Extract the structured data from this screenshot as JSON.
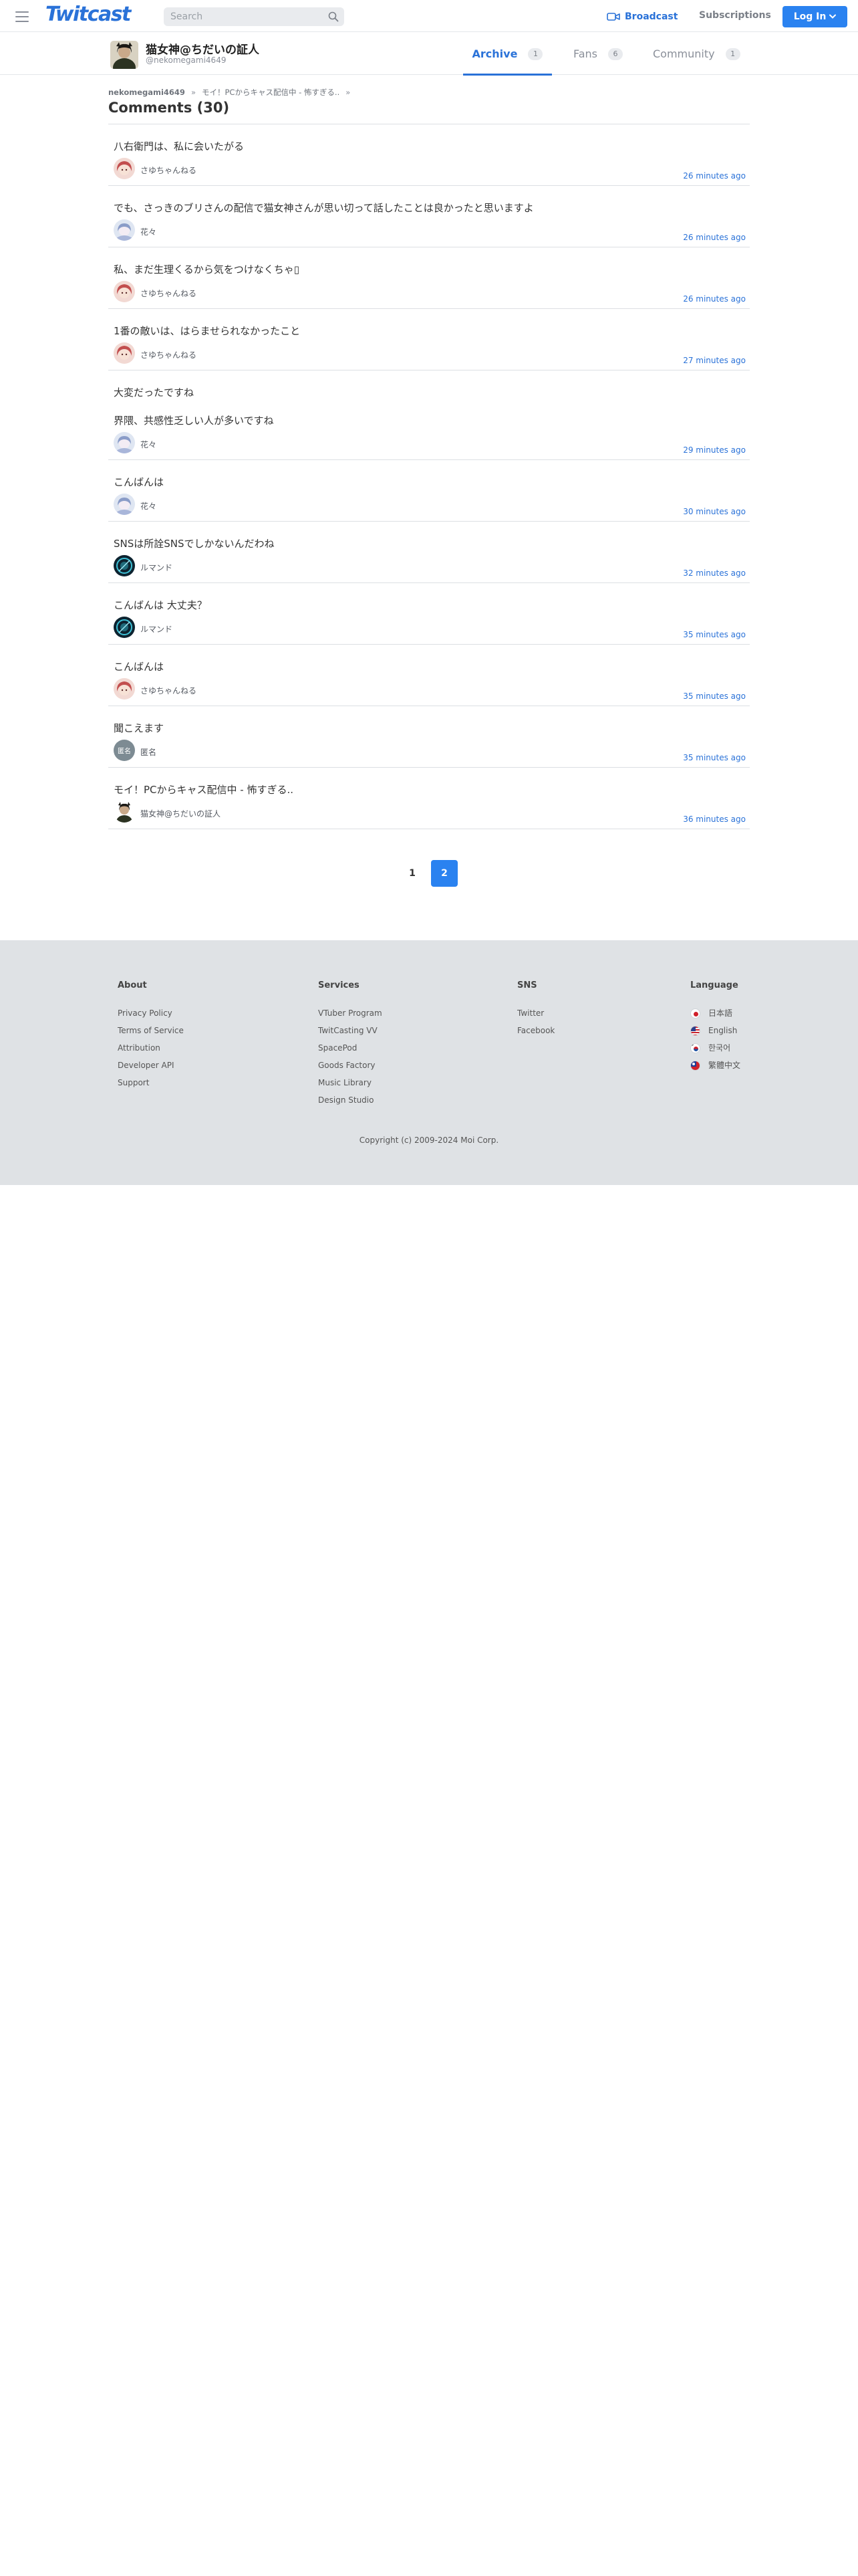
{
  "header": {
    "logo": "Twitcast",
    "search_placeholder": "Search",
    "broadcast_label": "Broadcast",
    "subscriptions_label": "Subscriptions",
    "login_label": "Log In"
  },
  "profile": {
    "name": "猫女神@ちだいの証人",
    "handle": "@nekomegami4649"
  },
  "tabs": [
    {
      "label": "Archive",
      "count": "1",
      "active": true
    },
    {
      "label": "Fans",
      "count": "6",
      "active": false
    },
    {
      "label": "Community",
      "count": "1",
      "active": false
    }
  ],
  "breadcrumb": {
    "user": "nekomegami4649",
    "separator": "»",
    "movie": "モイ！PCからキャス配信中 -   怖すぎる.."
  },
  "page_title": "Comments (30)",
  "comments": [
    {
      "text": "八右衛門は、私に会いたがる",
      "extra": "",
      "user": "さゆちゃんねる",
      "time": "26 minutes ago"
    },
    {
      "text": "でも、さっきのブリさんの配信で猫女神さんが思い切って話したことは良かったと思いますよ",
      "extra": "",
      "user": "花々",
      "time": "26 minutes ago"
    },
    {
      "text": "私、まだ生理くるから気をつけなくちゃ▯",
      "extra": "",
      "user": "さゆちゃんねる",
      "time": "26 minutes ago"
    },
    {
      "text": "1番の敵いは、はらませられなかったこと",
      "extra": "",
      "user": "さゆちゃんねる",
      "time": "27 minutes ago"
    },
    {
      "text": "大変だったですね",
      "extra": "界隈、共感性乏しい人が多いですね",
      "user": "花々",
      "time": "29 minutes ago"
    },
    {
      "text": "こんばんは",
      "extra": "",
      "user": "花々",
      "time": "30 minutes ago"
    },
    {
      "text": "SNSは所詮SNSでしかないんだわね",
      "extra": "",
      "user": "ルマンド",
      "time": "32 minutes ago"
    },
    {
      "text": "こんばんは 大丈夫？",
      "extra": "",
      "user": "ルマンド",
      "time": "35 minutes ago"
    },
    {
      "text": "こんばんは",
      "extra": "",
      "user": "さゆちゃんねる",
      "time": "35 minutes ago"
    },
    {
      "text": "聞こえます",
      "extra": "",
      "user": "匿名",
      "time": "35 minutes ago"
    },
    {
      "text": "モイ！PCからキャス配信中 -   怖すぎる..",
      "extra": "",
      "user": "猫女神@ちだいの証人",
      "time": "36 minutes ago"
    }
  ],
  "avatars": {
    "匿名": {
      "label": "匿名",
      "color": "#7d8b93"
    }
  },
  "pagination": {
    "pages": [
      "1",
      "2"
    ],
    "current": "2"
  },
  "footer": {
    "about": {
      "heading": "About",
      "links": [
        "Privacy Policy",
        "Terms of Service",
        "Attribution",
        "Developer API",
        "Support"
      ]
    },
    "services": {
      "heading": "Services",
      "links": [
        "VTuber Program",
        "TwitCasting VV",
        "SpacePod",
        "Goods Factory",
        "Music Library",
        "Design Studio"
      ]
    },
    "sns": {
      "heading": "SNS",
      "links": [
        "Twitter",
        "Facebook"
      ]
    },
    "language": {
      "heading": "Language",
      "links": [
        "日本語",
        "English",
        "한국어",
        "繁體中文"
      ]
    },
    "copyright": "Copyright (c) 2009-2024 Moi Corp."
  },
  "colors": {
    "accent": "#2a72d8",
    "button": "#2a82f0",
    "footer_bg": "#dfe2e5"
  }
}
